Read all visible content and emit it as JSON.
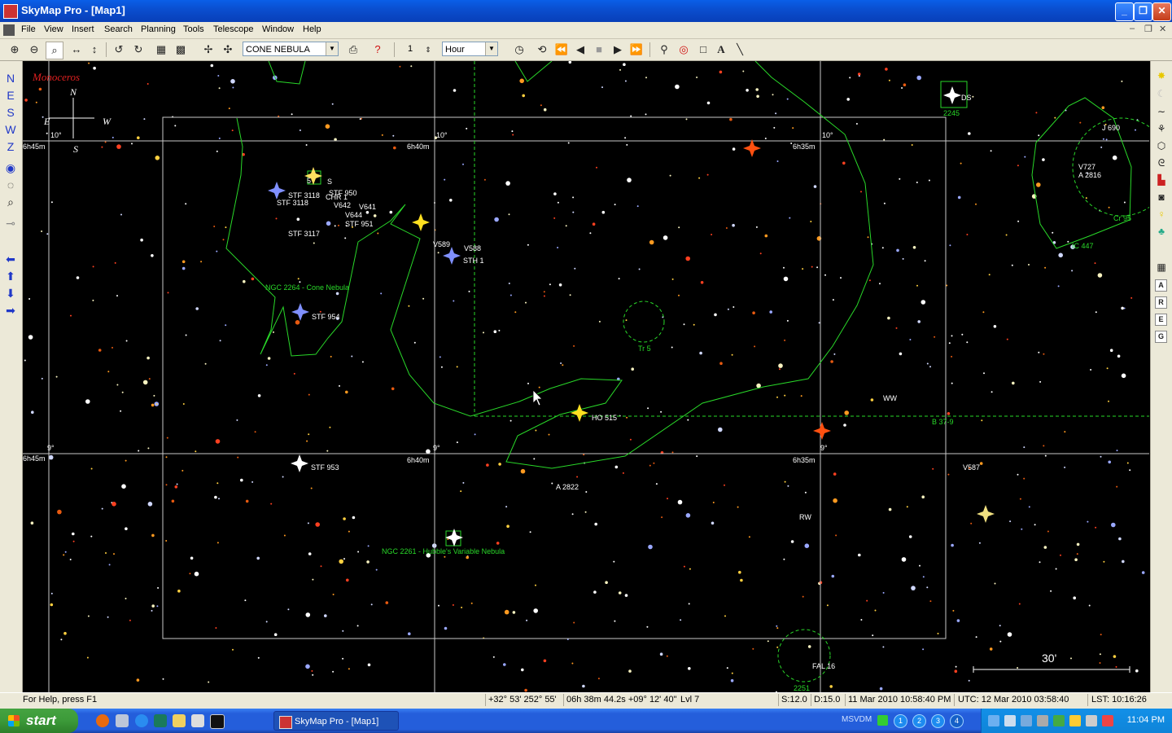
{
  "window": {
    "title": "SkyMap Pro - [Map1]",
    "controls": {
      "minimize": "_",
      "restore": "❐",
      "close": "✕"
    }
  },
  "menu": [
    "File",
    "View",
    "Insert",
    "Search",
    "Planning",
    "Tools",
    "Telescope",
    "Window",
    "Help"
  ],
  "toolbar": {
    "object_combo": "CONE NEBULA",
    "step_value": "1",
    "time_unit": "Hour"
  },
  "left_toolbar": [
    "N",
    "E",
    "S",
    "W",
    "Z"
  ],
  "right_toolbar": [
    "A",
    "R",
    "E",
    "G"
  ],
  "map": {
    "constellation_label": "Monoceros",
    "compass": {
      "north": "N",
      "east": "E",
      "south": "S",
      "west": "W"
    },
    "ra_labels": [
      "6h45m",
      "6h40m",
      "6h35m",
      "6h45m",
      "6h40m",
      "6h35m"
    ],
    "dec_labels": [
      "10°",
      "10°",
      "10°",
      "9°",
      "9°",
      "9°"
    ],
    "white_labels": [
      "STF 3118",
      "CHR 1",
      "STF 950",
      "V642",
      "V641",
      "V644",
      "STF 951",
      "STF 3118",
      "STF 3117",
      "V589",
      "V588",
      "STH 1",
      "STF 954",
      "WW",
      "HO 515",
      "V587",
      "STF 953",
      "A 2822",
      "RW",
      "FAL 16",
      "J 690",
      "V727",
      "A 2816",
      "S",
      "5",
      "DS"
    ],
    "green_labels": [
      "NGC 2264 - Cone Nebula",
      "NGC 2261 - Hubble's Variable Nebula",
      "Tr 5",
      "2245",
      "Cr 95",
      "IC 447",
      "B 37-9",
      "2251"
    ],
    "scale_label": "30'"
  },
  "status": {
    "help": "For Help, press F1",
    "altaz": "+32° 53'  252° 55'",
    "radec": "06h 38m 44.2s  +09° 12' 40\"",
    "level": "Lvl 7",
    "scale": "S:12.0",
    "diameter": "D:15.0",
    "local_time": "11 Mar 2010 10:58:40 PM",
    "utc": "UTC: 12 Mar 2010 03:58:40",
    "lst": "LST: 10:16:26"
  },
  "taskbar": {
    "start_label": "start",
    "task_item": "SkyMap Pro - [Map1]",
    "language": "MSVDM",
    "virtual_desktops": [
      "1",
      "2",
      "3",
      "4"
    ],
    "clock": "11:04 PM"
  },
  "colors": {
    "titlebar": "#0a5fe8",
    "chrome": "#ece9d8",
    "constellation_line": "#29d829",
    "grid": "#c8c8c8"
  }
}
